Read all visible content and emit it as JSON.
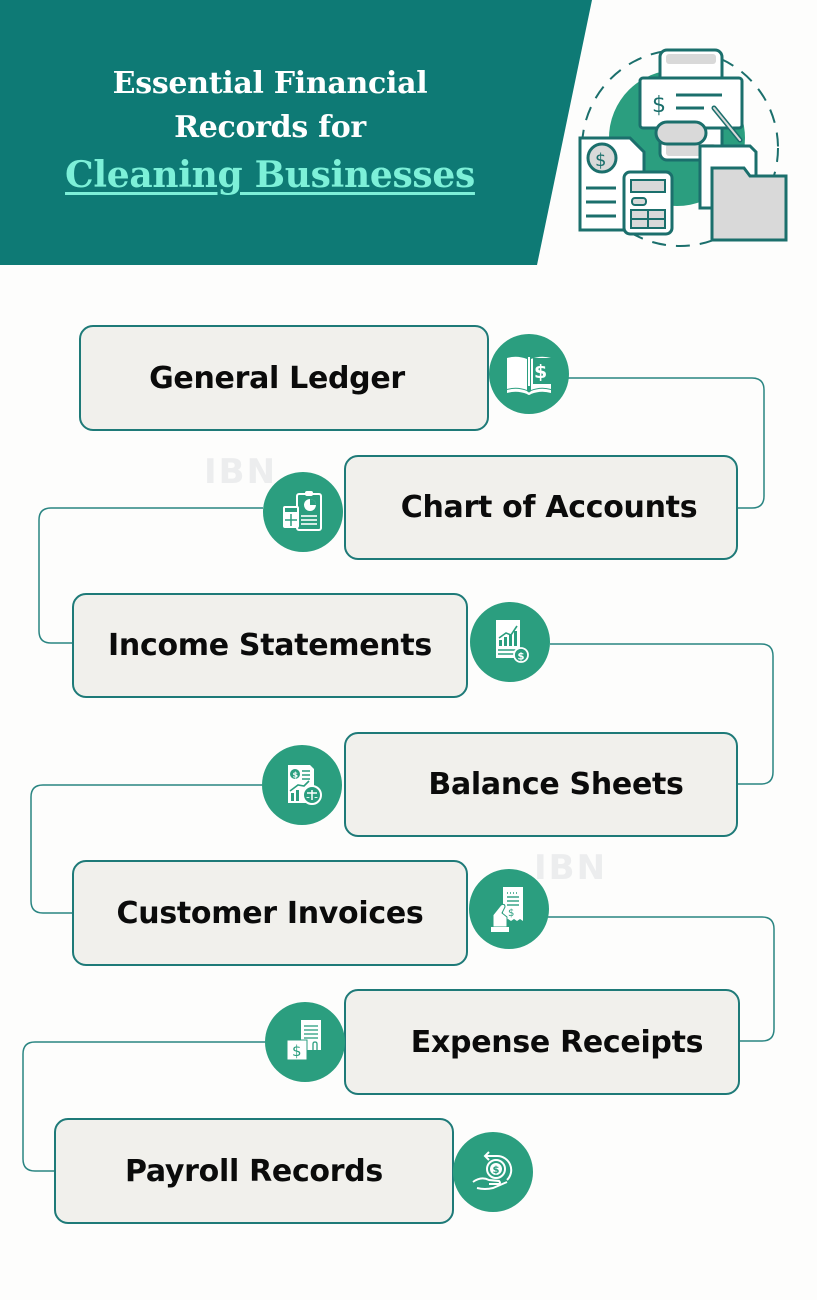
{
  "header": {
    "title_line1": "Essential Financial",
    "title_line2": "Records for",
    "title_accent": "Cleaning Businesses",
    "hero_icon": "financial-documents-illustration"
  },
  "colors": {
    "header_bg": "#0e7a75",
    "accent_text": "#7df0d8",
    "icon_bg": "#2b9e7f",
    "box_border": "#1e7a78",
    "box_fill": "#f1f0ec",
    "connector": "#2a8582"
  },
  "watermark": "IBN",
  "records": [
    {
      "label": "General Ledger",
      "icon": "ledger-book-dollar-icon"
    },
    {
      "label": "Chart of Accounts",
      "icon": "clipboard-pie-chart-icon"
    },
    {
      "label": "Income Statements",
      "icon": "growth-report-dollar-icon"
    },
    {
      "label": "Balance Sheets",
      "icon": "report-balance-scale-icon"
    },
    {
      "label": "Customer Invoices",
      "icon": "hand-receipt-icon"
    },
    {
      "label": "Expense Receipts",
      "icon": "receipt-dollar-icon"
    },
    {
      "label": "Payroll Records",
      "icon": "hand-coin-cycle-icon"
    }
  ]
}
